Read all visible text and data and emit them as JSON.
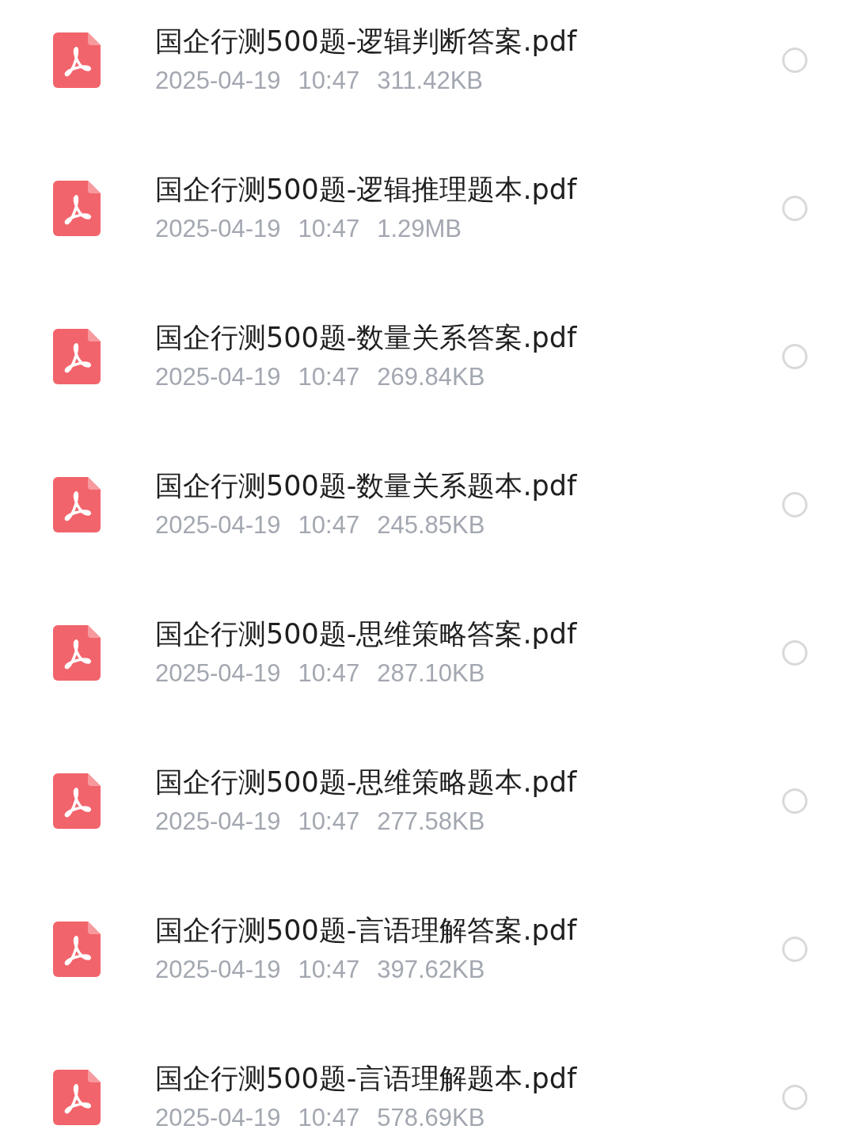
{
  "files": [
    {
      "name": "国企行测500题-逻辑判断答案.pdf",
      "date": "2025-04-19",
      "time": "10:47",
      "size": "311.42KB",
      "selected": false
    },
    {
      "name": "国企行测500题-逻辑推理题本.pdf",
      "date": "2025-04-19",
      "time": "10:47",
      "size": "1.29MB",
      "selected": false
    },
    {
      "name": "国企行测500题-数量关系答案.pdf",
      "date": "2025-04-19",
      "time": "10:47",
      "size": "269.84KB",
      "selected": false
    },
    {
      "name": "国企行测500题-数量关系题本.pdf",
      "date": "2025-04-19",
      "time": "10:47",
      "size": "245.85KB",
      "selected": false
    },
    {
      "name": "国企行测500题-思维策略答案.pdf",
      "date": "2025-04-19",
      "time": "10:47",
      "size": "287.10KB",
      "selected": false
    },
    {
      "name": "国企行测500题-思维策略题本.pdf",
      "date": "2025-04-19",
      "time": "10:47",
      "size": "277.58KB",
      "selected": false
    },
    {
      "name": "国企行测500题-言语理解答案.pdf",
      "date": "2025-04-19",
      "time": "10:47",
      "size": "397.62KB",
      "selected": false
    },
    {
      "name": "国企行测500题-言语理解题本.pdf",
      "date": "2025-04-19",
      "time": "10:47",
      "size": "578.69KB",
      "selected": false
    }
  ]
}
